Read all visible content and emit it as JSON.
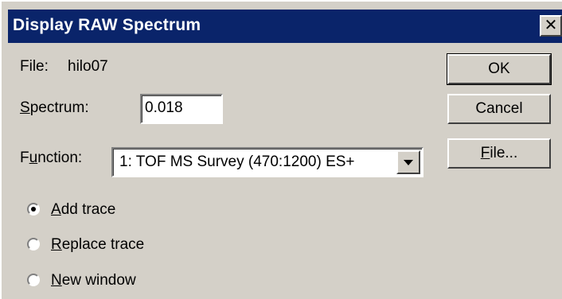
{
  "dialog": {
    "title": "Display RAW Spectrum",
    "close_glyph": "✕"
  },
  "file": {
    "label": "File:",
    "value": "hilo07"
  },
  "spectrum": {
    "label_first": "S",
    "label_rest": "pectrum:",
    "value": "0.018"
  },
  "function": {
    "label_first": "F",
    "label_under": "u",
    "label_rest": "nction:",
    "selected": "1: TOF MS Survey (470:1200) ES+"
  },
  "buttons": {
    "ok": "OK",
    "cancel": "Cancel",
    "file_under": "F",
    "file_rest": "ile..."
  },
  "trace_options": [
    {
      "under": "A",
      "rest": "dd trace",
      "checked": true
    },
    {
      "under": "R",
      "rest": "eplace trace",
      "checked": false
    },
    {
      "under": "N",
      "rest": "ew window",
      "checked": false
    }
  ]
}
